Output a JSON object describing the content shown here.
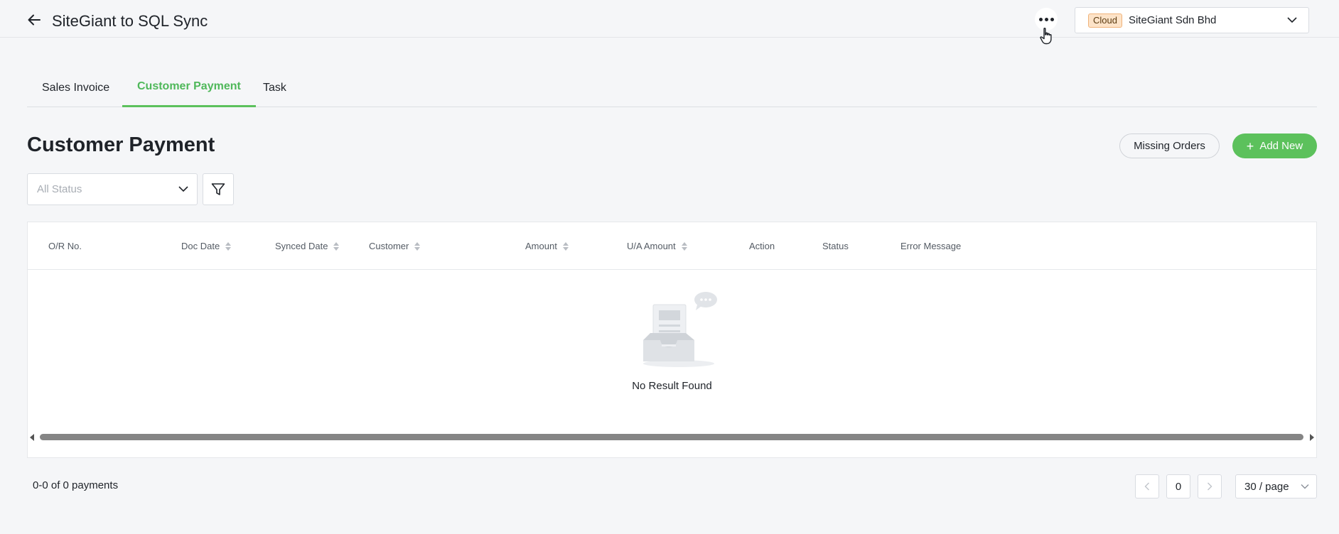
{
  "header": {
    "title": "SiteGiant to SQL Sync",
    "account": {
      "badge": "Cloud",
      "company": "SiteGiant Sdn Bhd"
    }
  },
  "tabs": [
    {
      "label": "Sales Invoice",
      "active": false
    },
    {
      "label": "Customer Payment",
      "active": true
    },
    {
      "label": "Task",
      "active": false
    }
  ],
  "page": {
    "title": "Customer Payment",
    "missing_orders_label": "Missing Orders",
    "add_new_label": "Add New"
  },
  "filters": {
    "status_placeholder": "All Status"
  },
  "table": {
    "columns": [
      {
        "label": "O/R No.",
        "sortable": false
      },
      {
        "label": "Doc Date",
        "sortable": true
      },
      {
        "label": "Synced Date",
        "sortable": true
      },
      {
        "label": "Customer",
        "sortable": true
      },
      {
        "label": "Amount",
        "sortable": true
      },
      {
        "label": "U/A Amount",
        "sortable": true
      },
      {
        "label": "Action",
        "sortable": false
      },
      {
        "label": "Status",
        "sortable": false
      },
      {
        "label": "Error Message",
        "sortable": false
      }
    ],
    "empty_text": "No Result Found"
  },
  "footer": {
    "summary": "0-0 of 0 payments",
    "current_page": "0",
    "page_size": "30 / page"
  },
  "colors": {
    "accent": "#5cc15c",
    "background": "#f5f6f8"
  },
  "icons": {
    "back": "arrow-left-icon",
    "more": "more-horizontal-icon",
    "filter": "funnel-icon",
    "chevron": "chevron-down-icon"
  }
}
